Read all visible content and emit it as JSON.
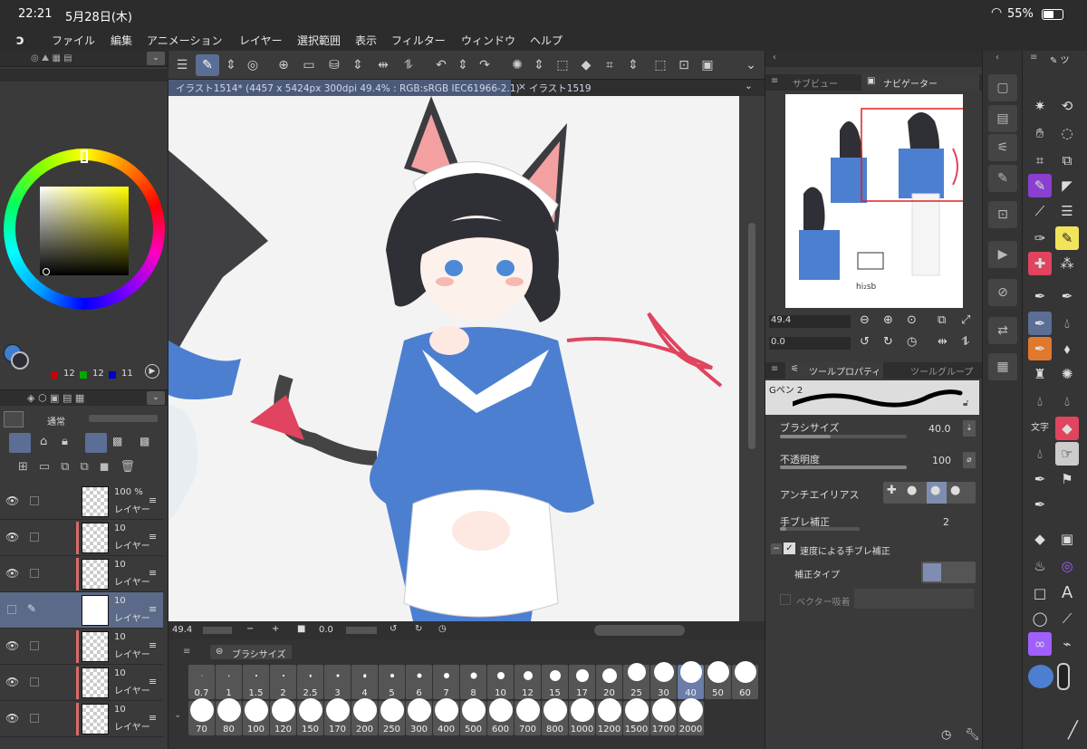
{
  "status": {
    "time": "22:21",
    "date": "5月28日(木)",
    "battery": "55%"
  },
  "menu": [
    "ファイル",
    "編集",
    "アニメーション",
    "レイヤー",
    "選択範囲",
    "表示",
    "フィルター",
    "ウィンドウ",
    "ヘルプ"
  ],
  "tabs": {
    "active": "イラスト1514* (4457 x 5424px 300dpi 49.4% : RGB:sRGB IEC61966-2.1)",
    "other": "イラスト1519"
  },
  "color": {
    "r": "12",
    "g": "12",
    "b": "11",
    "main": "#2c2c34",
    "sub": "#3e7fd0"
  },
  "layers": {
    "blend_mode": "通常",
    "rows": [
      {
        "pct": "100 %",
        "name": "レイヤー"
      },
      {
        "pct": "10",
        "name": "レイヤー"
      },
      {
        "pct": "10",
        "name": "レイヤー"
      },
      {
        "pct": "10",
        "name": "レイヤー"
      },
      {
        "pct": "10",
        "name": "レイヤー"
      },
      {
        "pct": "10",
        "name": "レイヤー"
      },
      {
        "pct": "10",
        "name": "レイヤー"
      }
    ]
  },
  "canvas_bar": {
    "zoom": "49.4",
    "rotation": "0.0"
  },
  "navigator": {
    "tab_subview": "サブビュー",
    "tab_navigator": "ナビゲーター",
    "zoom": "49.4",
    "rotation": "0.0"
  },
  "tool_property": {
    "tab_prop": "ツールプロパティ",
    "tab_group": "ツールグループ",
    "brush_name": "Gペン 2",
    "brush_size_label": "ブラシサイズ",
    "brush_size_value": "40.0",
    "opacity_label": "不透明度",
    "opacity_value": "100",
    "antialias_label": "アンチエイリアス",
    "stabilization_label": "手ブレ補正",
    "stabilization_value": "2",
    "speed_stab_label": "速度による手ブレ補正",
    "correction_type_label": "補正タイプ",
    "vector_snap_label": "ベクター吸着"
  },
  "brush_size_panel": {
    "title": "ブラシサイズ",
    "row1": [
      "0.7",
      "1",
      "1.5",
      "2",
      "2.5",
      "3",
      "4",
      "5",
      "6",
      "7",
      "8",
      "10",
      "12",
      "15",
      "17",
      "20",
      "25",
      "30",
      "40",
      "50",
      "60"
    ],
    "row2": [
      "70",
      "80",
      "100",
      "120",
      "150",
      "170",
      "200",
      "250",
      "300",
      "400",
      "500",
      "600",
      "700",
      "800",
      "1000",
      "1200",
      "1500",
      "1700",
      "2000"
    ],
    "selected": "40"
  }
}
